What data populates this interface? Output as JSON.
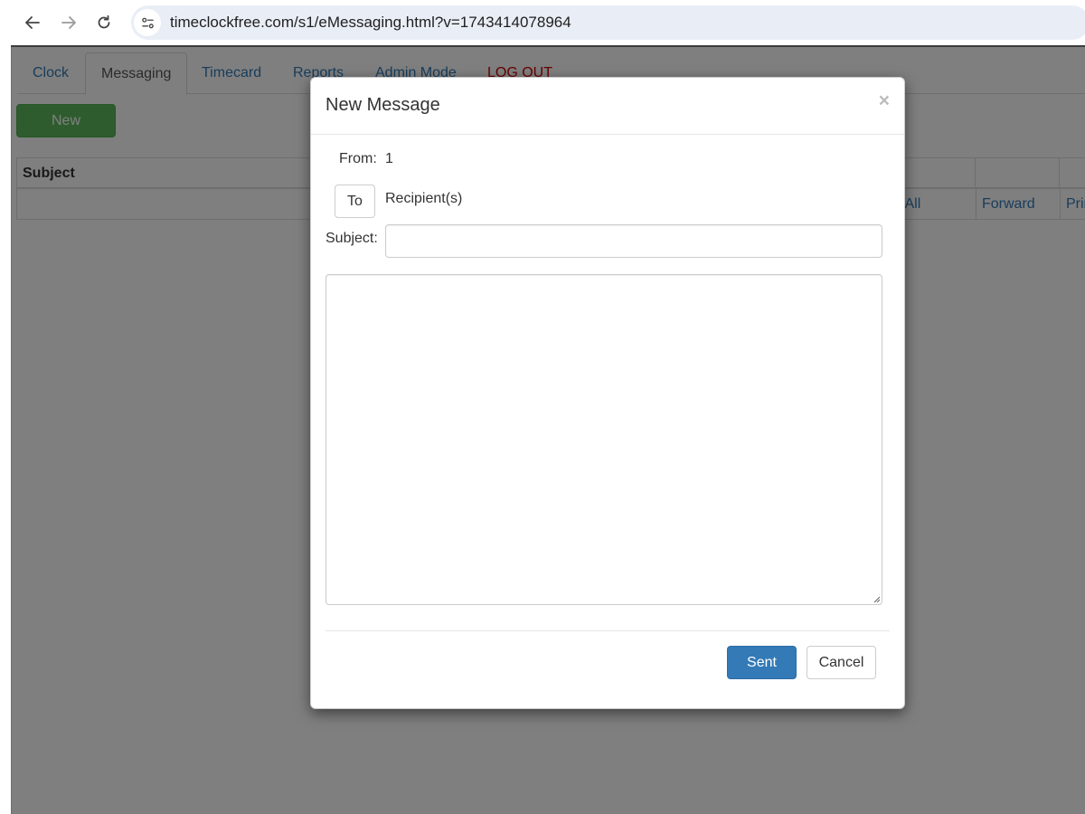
{
  "browser": {
    "url": "timeclockfree.com/s1/eMessaging.html?v=1743414078964",
    "icons": [
      "back-arrow-icon",
      "forward-arrow-icon",
      "reload-icon",
      "site-info-icon"
    ]
  },
  "tabs": [
    {
      "label": "Clock"
    },
    {
      "label": "Messaging"
    },
    {
      "label": "Timecard"
    },
    {
      "label": "Reports"
    },
    {
      "label": "Admin Mode"
    },
    {
      "label": "LOG OUT"
    }
  ],
  "toolbar": {
    "new_label": "New"
  },
  "table": {
    "header_subject": "Subject",
    "row_actions": [
      "Reply All",
      "Forward",
      "Print"
    ]
  },
  "modal": {
    "title": "New Message",
    "close_label": "×",
    "from_label": "From:",
    "from_value": "1",
    "to_button": "To",
    "recipients": "Recipient(s)",
    "subject_label": "Subject:",
    "subject_value": "",
    "body_value": "",
    "sent_label": "Sent",
    "cancel_label": "Cancel"
  },
  "colors": {
    "link": "#337ab7",
    "logout": "#cc0000",
    "new_button": "#5cb85c",
    "primary_button": "#337ab7"
  }
}
